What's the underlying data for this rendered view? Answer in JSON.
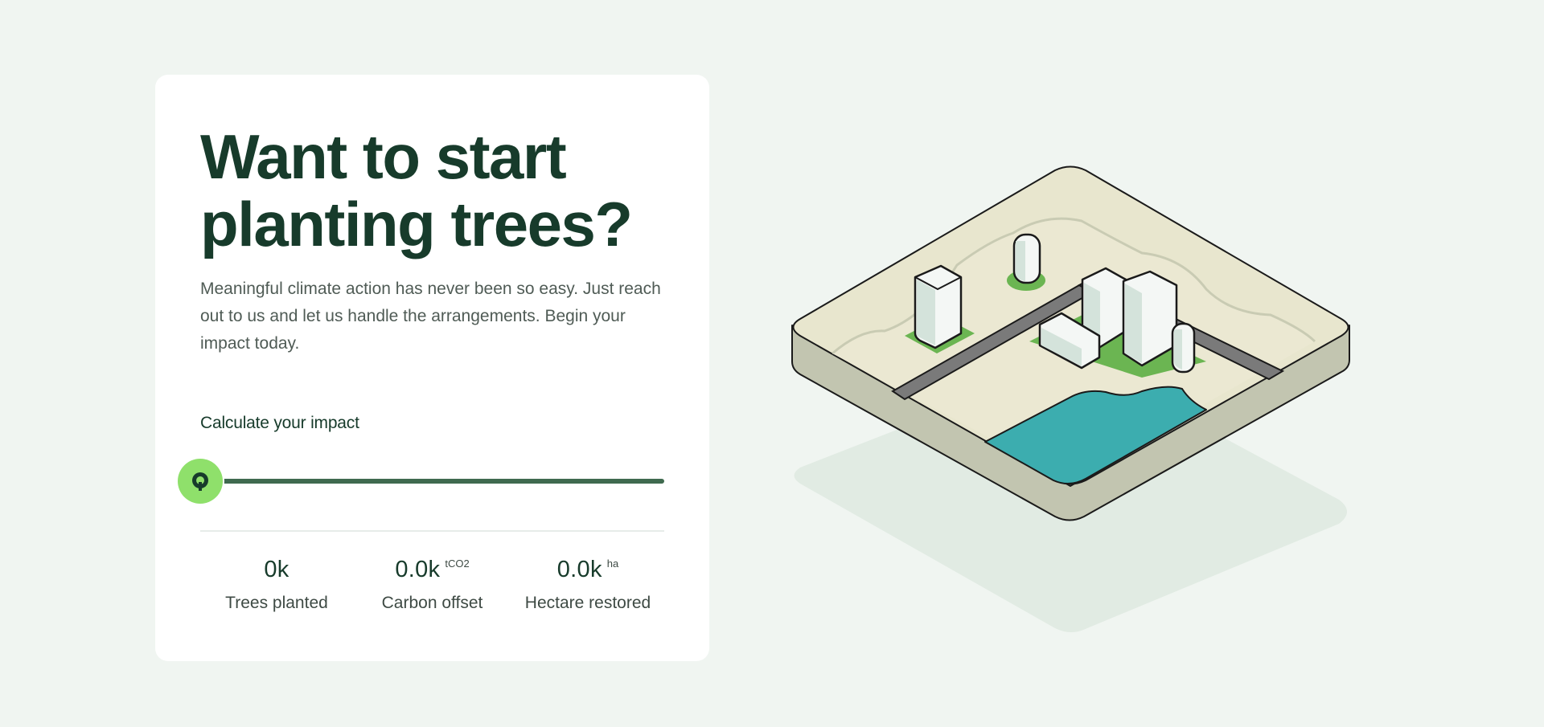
{
  "hero": {
    "title_line1": "Want to start",
    "title_line2": "planting trees?",
    "description": "Meaningful climate action has never been so easy. Just reach out to us and let us handle the arrangements. Begin your impact today."
  },
  "calculator": {
    "label": "Calculate your impact",
    "slider_value_fraction": 0,
    "thumb_icon": "leaf-logo-icon"
  },
  "stats": [
    {
      "value": "0k",
      "unit": "",
      "label": "Trees planted"
    },
    {
      "value": "0.0k",
      "unit": "tCO2",
      "label": "Carbon offset"
    },
    {
      "value": "0.0k",
      "unit": "ha",
      "label": "Hectare restored"
    }
  ],
  "colors": {
    "page_bg": "#f0f5f1",
    "heading": "#173b2b",
    "slider_track": "#3f6a4f",
    "slider_thumb": "#8fe06b",
    "water": "#3cadaf",
    "grass": "#6bb552"
  },
  "illustration": {
    "name": "isometric-city-map-illustration"
  }
}
